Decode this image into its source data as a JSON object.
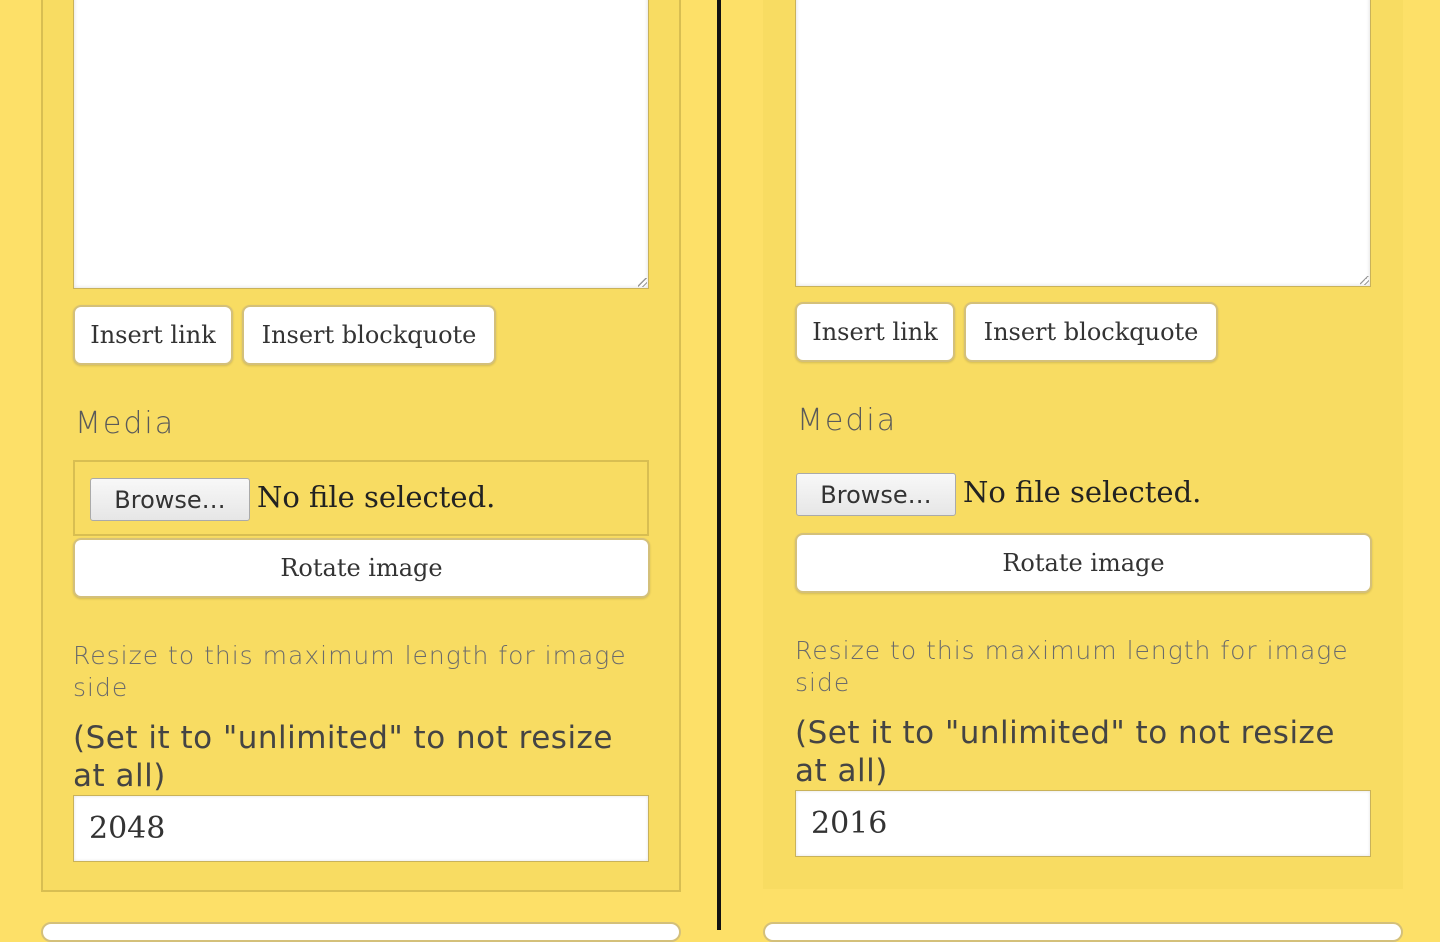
{
  "left": {
    "insert_link": "Insert link",
    "insert_blockquote": "Insert blockquote",
    "media_label": "Media",
    "browse": "Browse…",
    "no_file": "No file selected.",
    "rotate": "Rotate image",
    "resize_hint": "Resize to this maximum length for image side",
    "unlimited_hint": "(Set it to \"unlimited\" to not resize at all)",
    "max_length": "2048"
  },
  "right": {
    "insert_link": "Insert link",
    "insert_blockquote": "Insert blockquote",
    "media_label": "Media",
    "browse": "Browse…",
    "no_file": "No file selected.",
    "rotate": "Rotate image",
    "resize_hint": "Resize to this maximum length for image side",
    "unlimited_hint": "(Set it to \"unlimited\" to not resize at all)",
    "max_length": "2016"
  }
}
